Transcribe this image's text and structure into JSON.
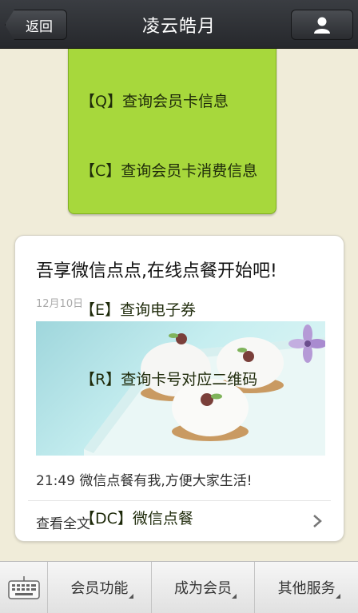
{
  "header": {
    "back_label": "返回",
    "title": "凌云皓月",
    "profile_icon": "user-icon"
  },
  "bubble": {
    "lines": [
      "【Q】查询会员卡信息",
      "【C】查询会员卡消费信息",
      "",
      "【E】查询电子券",
      "【R】查询卡号对应二维码",
      "",
      "【DC】微信点餐"
    ]
  },
  "article": {
    "title": "吾享微信点点,在线点餐开始吧!",
    "date": "12月10日",
    "summary": "21:49 微信点餐有我,方便大家生活!",
    "read_more": "查看全文",
    "chevron_icon": "chevron-right-icon"
  },
  "bottom_bar": {
    "keyboard_icon": "keyboard-icon",
    "menus": [
      {
        "label": "会员功能"
      },
      {
        "label": "成为会员"
      },
      {
        "label": "其他服务"
      }
    ]
  }
}
